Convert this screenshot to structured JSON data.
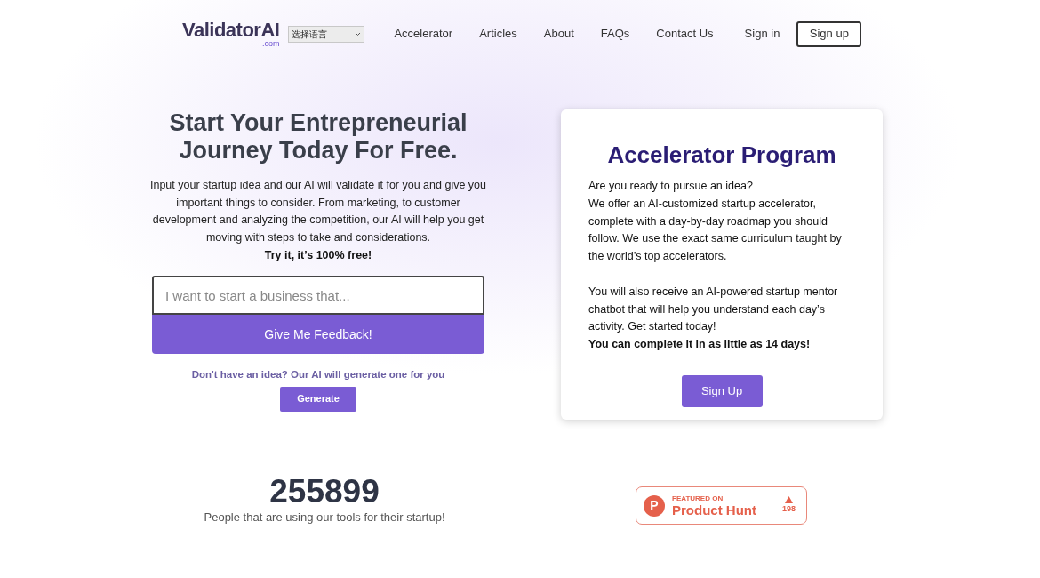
{
  "header": {
    "logo": "ValidatorAI",
    "logo_suffix": ".com",
    "language_select": "选择语言",
    "nav": [
      {
        "label": "Accelerator"
      },
      {
        "label": "Articles"
      },
      {
        "label": "About"
      },
      {
        "label": "FAQs"
      },
      {
        "label": "Contact Us"
      }
    ],
    "sign_in": "Sign in",
    "sign_up": "Sign up"
  },
  "hero": {
    "title": "Start Your Entrepreneurial Journey Today For Free.",
    "description": "Input your startup idea and our AI will validate it for you and give you important things to consider. From marketing, to customer development and analyzing the competition, our AI will help you get moving with steps to take and considerations.",
    "tagline": "Try it, it’s 100% free!",
    "idea_input": {
      "placeholder": "I want to start a business that..."
    },
    "feedback_button": "Give Me Feedback!",
    "generate_prompt": "Don't have an idea? Our AI will generate one for you",
    "generate_button": "Generate"
  },
  "accelerator_card": {
    "title": "Accelerator Program",
    "paragraphs": [
      {
        "text": "Are you ready to pursue an idea?",
        "bold": false
      },
      {
        "text": "We offer an AI-customized startup accelerator, complete with a day-by-day roadmap you should follow. We use the exact same curriculum taught by the world’s top accelerators.",
        "bold": false
      },
      {
        "text": "You will also receive an AI-powered startup mentor chatbot that will help you understand each day’s activity. Get started today!",
        "bold": false,
        "gap_before": true
      },
      {
        "text": "You can complete it in as little as 14 days!",
        "bold": true
      }
    ],
    "button": "Sign Up"
  },
  "stats": {
    "count": "255899",
    "caption": "People that are using our tools for their startup!"
  },
  "product_hunt_badge": {
    "letter": "P",
    "eyebrow": "FEATURED ON",
    "name": "Product Hunt",
    "votes": "198"
  }
}
